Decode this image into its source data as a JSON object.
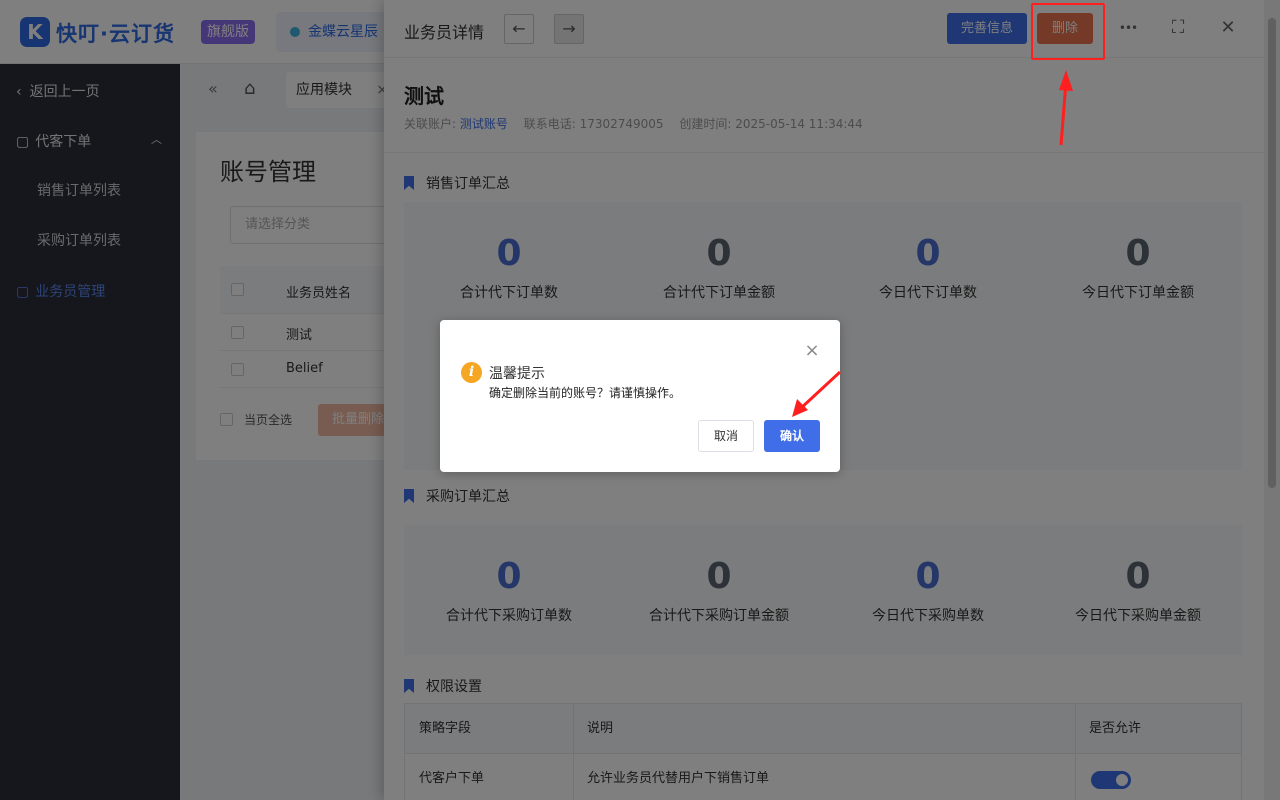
{
  "app": {
    "logo_letter": "K",
    "name": "快叮·云订货",
    "edition": "旗舰版",
    "brand": "金蝶云星辰"
  },
  "sidebar": {
    "back": "返回上一页",
    "group": "代客下单",
    "items": [
      {
        "label": "销售订单列表"
      },
      {
        "label": "采购订单列表"
      },
      {
        "label": "业务员管理"
      }
    ]
  },
  "tabs": {
    "collapse_icon": "«",
    "home_icon": "⌂",
    "open_tab": "应用模块",
    "close": "×"
  },
  "account_page": {
    "title": "账号管理",
    "search_placeholder": "请选择分类",
    "columns": [
      "业务员姓名"
    ],
    "rows": [
      "测试",
      "Belief"
    ],
    "select_all": "当页全选",
    "bulk_delete": "批量删除"
  },
  "drawer": {
    "title": "业务员详情",
    "prev": "←",
    "next": "→",
    "complete_info": "完善信息",
    "delete": "删除",
    "more": "•••",
    "fullscreen": "⛶",
    "close": "✕",
    "user": {
      "name": "测试",
      "linked_label": "关联账户:",
      "linked_value": "测试账号",
      "phone": "联系电话: 17302749005",
      "created": "创建时间: 2025-05-14 11:34:44"
    },
    "sales_summary": {
      "title": "销售订单汇总",
      "stats": [
        {
          "value": "0",
          "label": "合计代下订单数"
        },
        {
          "value": "0",
          "label": "合计代下订单金额"
        },
        {
          "value": "0",
          "label": "今日代下订单数"
        },
        {
          "value": "0",
          "label": "今日代下订单金额"
        }
      ]
    },
    "purchase_summary": {
      "title": "采购订单汇总",
      "stats": [
        {
          "value": "0",
          "label": "合计代下采购订单数"
        },
        {
          "value": "0",
          "label": "合计代下采购订单金额"
        },
        {
          "value": "0",
          "label": "今日代下采购单数"
        },
        {
          "value": "0",
          "label": "今日代下采购单金额"
        }
      ]
    },
    "permissions": {
      "title": "权限设置",
      "headers": [
        "策略字段",
        "说明",
        "是否允许"
      ],
      "rows": [
        {
          "field": "代客户下单",
          "desc": "允许业务员代替用户下销售订单",
          "allowed": true
        }
      ]
    }
  },
  "modal": {
    "close": "×",
    "icon": "i",
    "title": "温馨提示",
    "message": "确定删除当前的账号？请谨慎操作。",
    "cancel": "取消",
    "confirm": "确认"
  },
  "colors": {
    "primary": "#3f6ee8",
    "danger": "#e8734e",
    "highlight": "#ff1f1f",
    "warning": "#f5a623"
  }
}
